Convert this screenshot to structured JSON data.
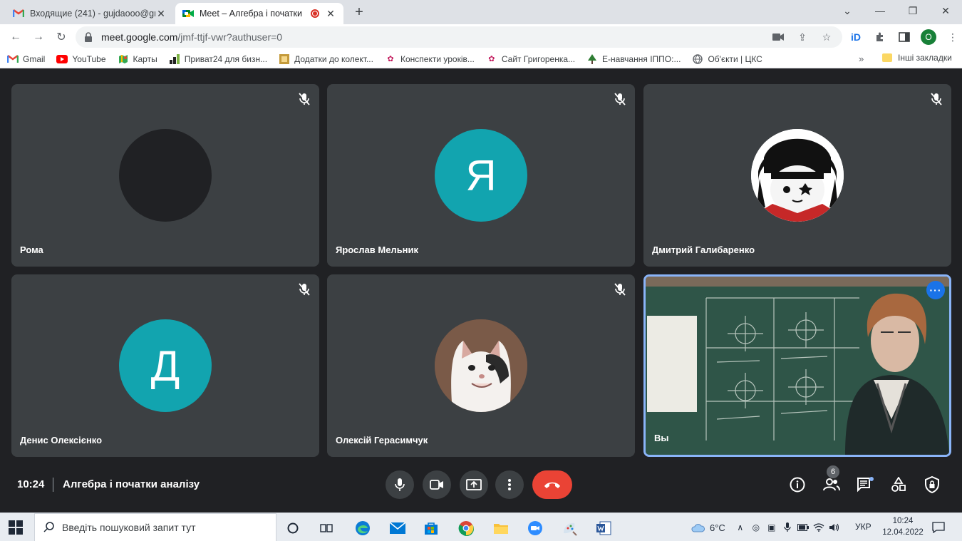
{
  "browser": {
    "tabs": [
      {
        "title": "Входящие (241) - gujdaooo@gm",
        "active": false,
        "icon": "gmail-icon"
      },
      {
        "title": "Meet – Алгебра і початки а",
        "active": true,
        "icon": "meet-icon",
        "recording": true
      }
    ],
    "url_host": "meet.google.com",
    "url_path": "/jmf-ttjf-vwr?authuser=0",
    "profile_initial": "O",
    "bookmarks": [
      {
        "label": "Gmail",
        "icon": "gmail-icon"
      },
      {
        "label": "YouTube",
        "icon": "youtube-icon"
      },
      {
        "label": "Карты",
        "icon": "maps-icon"
      },
      {
        "label": "Приват24 для бизн...",
        "icon": "privat-icon"
      },
      {
        "label": "Додатки до колект...",
        "icon": "folder-doc-icon"
      },
      {
        "label": "Конспекти уроків...",
        "icon": "flower-icon"
      },
      {
        "label": "Сайт Григоренка...",
        "icon": "flower-icon"
      },
      {
        "label": "Е-навчання ІППО:...",
        "icon": "tree-icon"
      },
      {
        "label": "Об'єкти | ЦКС",
        "icon": "globe-icon"
      }
    ],
    "bookmarks_more": "»",
    "bookmarks_other": "Інші закладки"
  },
  "meet": {
    "participants": [
      {
        "name": "Рома",
        "avatar_type": "dark",
        "initial": "",
        "muted": true
      },
      {
        "name": "Ярослав Мельник",
        "avatar_type": "letter",
        "initial": "Я",
        "muted": true
      },
      {
        "name": "Дмитрий Галибаренко",
        "avatar_type": "anime",
        "initial": "",
        "muted": true
      },
      {
        "name": "Денис Олексієнко",
        "avatar_type": "letter",
        "initial": "Д",
        "muted": true
      },
      {
        "name": "Олексій Герасимчук",
        "avatar_type": "cat",
        "initial": "",
        "muted": true
      },
      {
        "name": "Вы",
        "avatar_type": "video",
        "initial": "",
        "muted": false
      }
    ],
    "time": "10:24",
    "meeting_title": "Алгебра і початки аналізу",
    "participant_count": "6",
    "colors": {
      "stage": "#202124",
      "tile": "#3c4043",
      "teal_avatar": "#12a4af",
      "end_call": "#ea4335",
      "self_border": "#8ab4f8"
    }
  },
  "taskbar": {
    "search_placeholder": "Введіть пошуковий запит тут",
    "temperature": "6°C",
    "language": "УКР",
    "time": "10:24",
    "date": "12.04.2022",
    "apps": [
      "task-view-icon",
      "edge-icon",
      "mail-icon",
      "store-icon",
      "chrome-icon",
      "explorer-icon",
      "zoom-icon",
      "paint-icon",
      "word-icon"
    ]
  }
}
